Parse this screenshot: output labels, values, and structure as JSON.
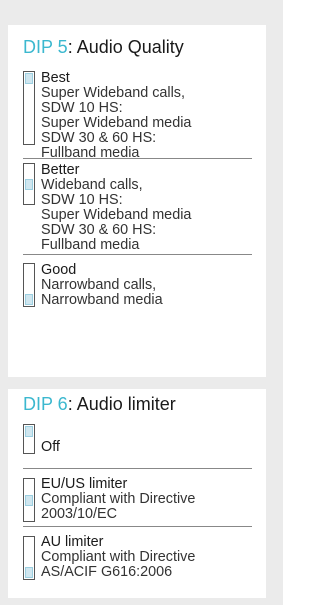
{
  "sections": [
    {
      "dip": "DIP 5",
      "title": ": Audio Quality",
      "options": [
        {
          "title": "Best",
          "lines": [
            "Super Wideband calls,",
            "SDW 10 HS:",
            "Super Wideband media",
            "SDW 30 & 60 HS:",
            "Fullband media"
          ],
          "switch_position": "top"
        },
        {
          "title": "Better",
          "lines": [
            "Wideband calls,",
            "SDW 10 HS:",
            "Super Wideband media",
            "SDW 30 & 60 HS:",
            "Fullband media"
          ],
          "switch_position": "middle"
        },
        {
          "title": "Good",
          "lines": [
            "Narrowband calls,",
            "Narrowband media"
          ],
          "switch_position": "bottom"
        }
      ]
    },
    {
      "dip": "DIP 6",
      "title": ": Audio limiter",
      "options": [
        {
          "title": "Off",
          "lines": [],
          "switch_position": "top"
        },
        {
          "title": "EU/US limiter",
          "lines": [
            "Compliant with Directive",
            "2003/10/EC"
          ],
          "switch_position": "middle"
        },
        {
          "title": "AU limiter",
          "lines": [
            "Compliant with Directive",
            "AS/ACIF G616:2006"
          ],
          "switch_position": "bottom"
        }
      ]
    }
  ]
}
